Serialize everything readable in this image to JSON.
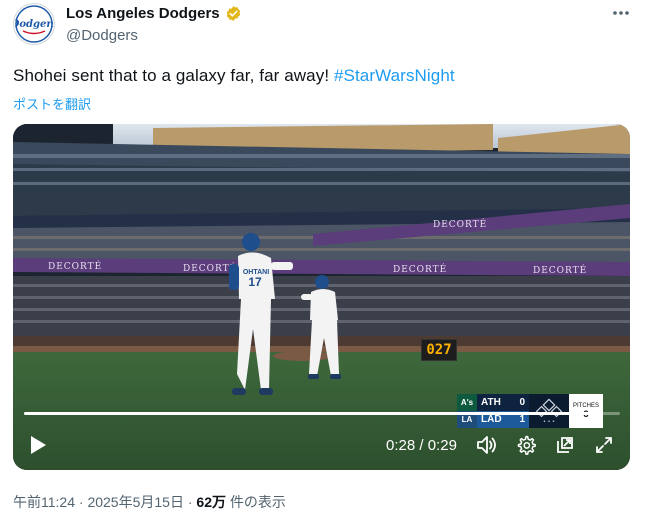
{
  "account": {
    "name": "Los Angeles Dodgers",
    "handle": "@Dodgers",
    "avatar_icon": "dodgers-logo-icon",
    "verified_icon": "verified-badge-icon",
    "verified_color": "#e2b719"
  },
  "tweet": {
    "text": "Shohei sent that to a galaxy far, far away! ",
    "hashtag": "#StarWarsNight",
    "translate_label": "ポストを翻訳",
    "hashtag_color": "#1d9bf0"
  },
  "video": {
    "player_jersey_name": "OHTANI",
    "player_jersey_number": "17",
    "pitch_clock": "027",
    "sponsor": "DECORTÉ",
    "scoreboard": {
      "away_logo": "A's",
      "away_team": "ATH",
      "away_score": "0",
      "home_logo": "LA",
      "home_team": "LAD",
      "home_score": "1",
      "outs_label": "• • •",
      "pitches_label": "PITCHES",
      "pitches_count": "3"
    },
    "progress_fraction": 0.966,
    "current_time": "0:28",
    "separator": " / ",
    "duration": "0:29"
  },
  "footer": {
    "time": "午前11:24",
    "dot": " · ",
    "date": "2025年5月15日",
    "views": "62万",
    "views_suffix": " 件の表示"
  }
}
